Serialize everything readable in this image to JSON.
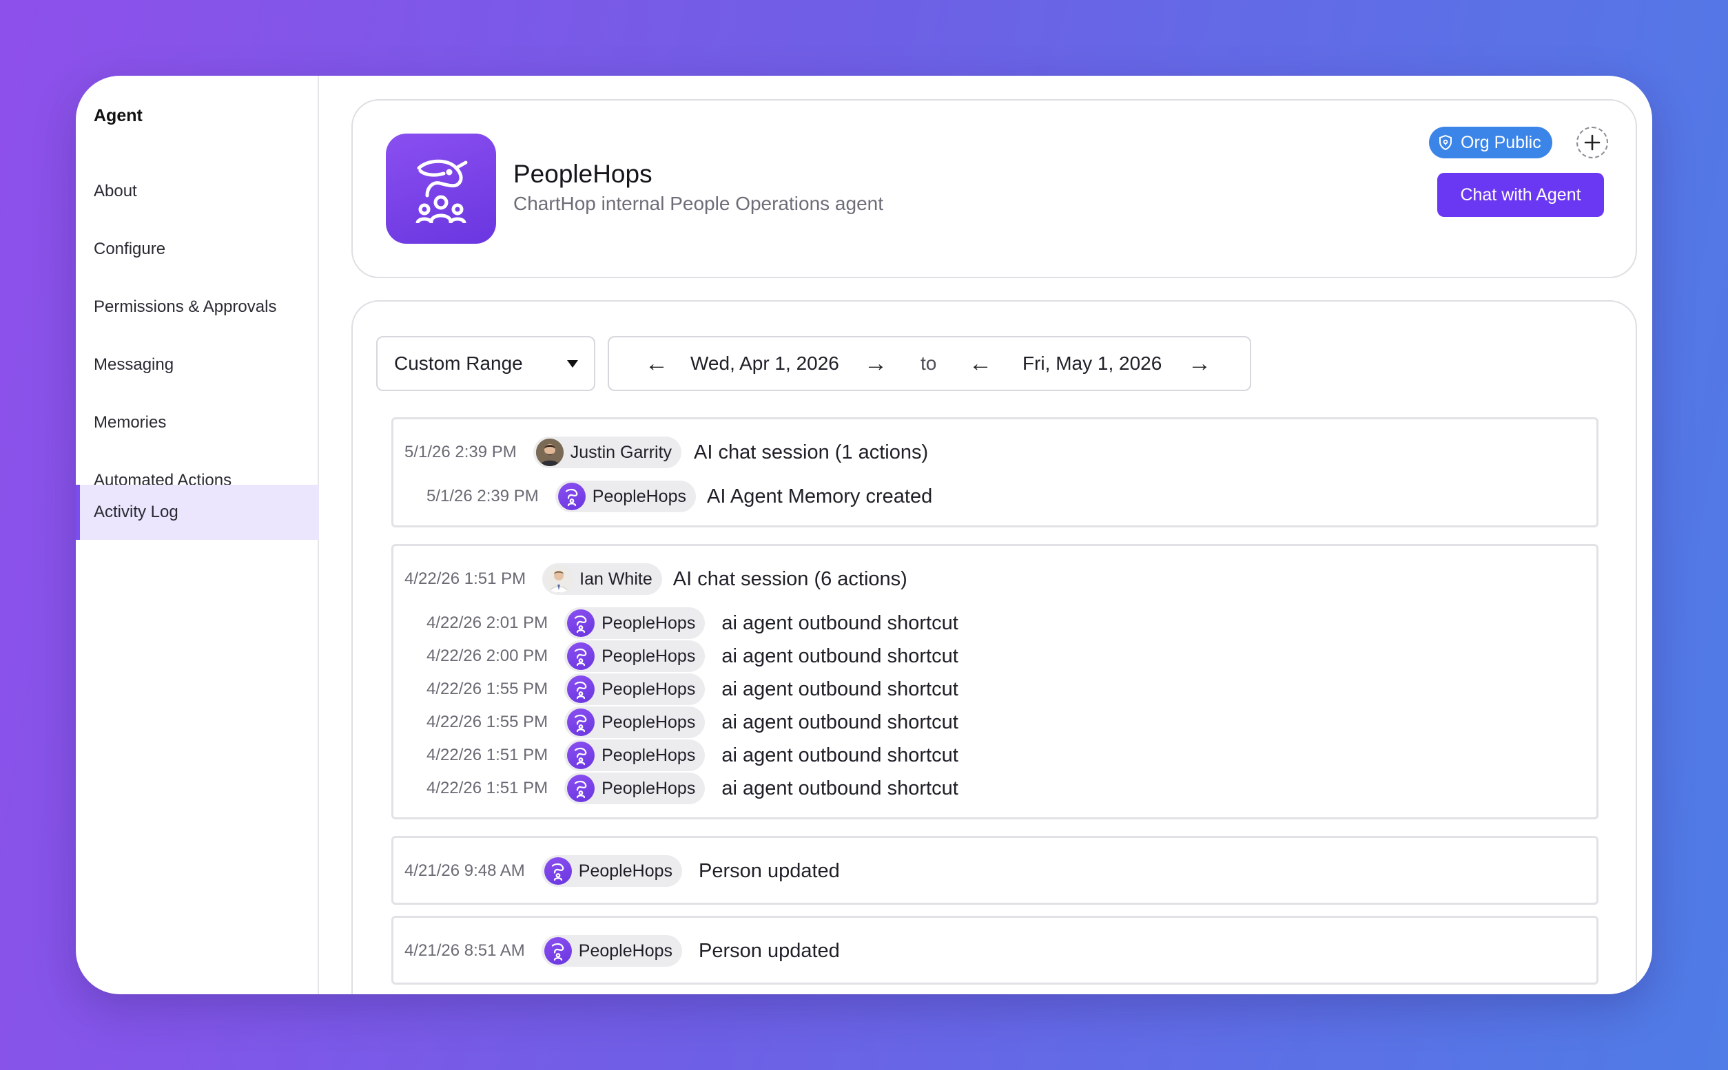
{
  "sidebar": {
    "heading": "Agent",
    "items": [
      {
        "label": "About",
        "active": false
      },
      {
        "label": "Configure",
        "active": false
      },
      {
        "label": "Permissions & Approvals",
        "active": false
      },
      {
        "label": "Messaging",
        "active": false
      },
      {
        "label": "Memories",
        "active": false
      },
      {
        "label": "Automated Actions",
        "active": false
      },
      {
        "label": "Activity Log",
        "active": true
      }
    ]
  },
  "header": {
    "agent_name": "PeopleHops",
    "agent_description": "ChartHop internal People Operations agent",
    "visibility_badge": "Org Public",
    "chat_button": "Chat with Agent"
  },
  "filters": {
    "range_select": "Custom Range",
    "start_date": "Wed, Apr 1, 2026",
    "separator": "to",
    "end_date": "Fri, May 1, 2026"
  },
  "log_groups": [
    {
      "time": "5/1/26 2:39 PM",
      "actor": "Justin Garrity",
      "actor_type": "person-justin",
      "action": "AI chat session (1 actions)",
      "children": [
        {
          "time": "5/1/26 2:39 PM",
          "actor": "PeopleHops",
          "action": "AI Agent Memory created"
        }
      ]
    },
    {
      "time": "4/22/26 1:51 PM",
      "actor": "Ian White",
      "actor_type": "person-ian",
      "action": "AI chat session (6 actions)",
      "children": [
        {
          "time": "4/22/26 2:01 PM",
          "actor": "PeopleHops",
          "action": "ai agent outbound shortcut"
        },
        {
          "time": "4/22/26 2:00 PM",
          "actor": "PeopleHops",
          "action": "ai agent outbound shortcut"
        },
        {
          "time": "4/22/26 1:55 PM",
          "actor": "PeopleHops",
          "action": "ai agent outbound shortcut"
        },
        {
          "time": "4/22/26 1:55 PM",
          "actor": "PeopleHops",
          "action": "ai agent outbound shortcut"
        },
        {
          "time": "4/22/26 1:51 PM",
          "actor": "PeopleHops",
          "action": "ai agent outbound shortcut"
        },
        {
          "time": "4/22/26 1:51 PM",
          "actor": "PeopleHops",
          "action": "ai agent outbound shortcut"
        }
      ]
    },
    {
      "time": "4/21/26 9:48 AM",
      "actor": "PeopleHops",
      "actor_type": "agent",
      "action": "Person updated",
      "children": []
    },
    {
      "time": "4/21/26 8:51 AM",
      "actor": "PeopleHops",
      "actor_type": "agent",
      "action": "Person updated",
      "children": []
    }
  ],
  "colors": {
    "accent": "#6a38f2",
    "badge": "#3b84e8",
    "active_nav_bg": "#ebe6fd"
  }
}
